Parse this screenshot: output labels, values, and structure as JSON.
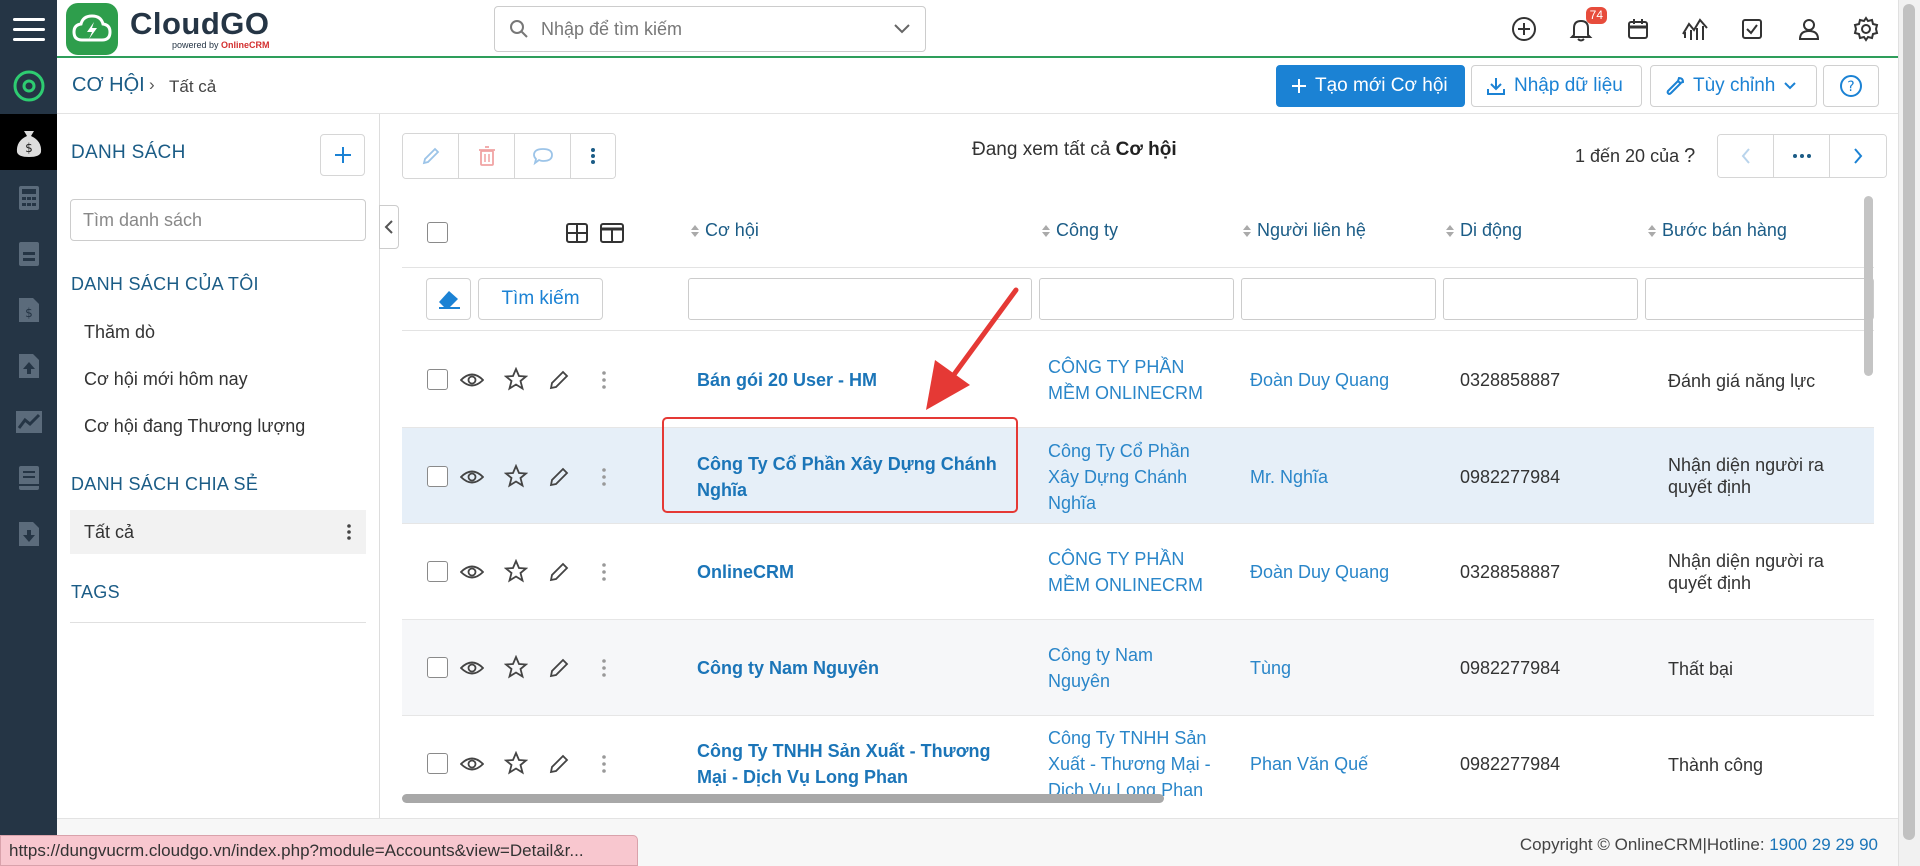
{
  "app": {
    "brand": "CloudGO",
    "brand_sub_prefix": "powered by",
    "brand_sub_name": "OnlineCRM",
    "brand_color": "#2e9e4c"
  },
  "topbar": {
    "search_placeholder": "Nhập để tìm kiếm",
    "notification_count": "74"
  },
  "header": {
    "module_title": "CƠ HỘI",
    "crumb_sep": "›",
    "crumb_current": "Tất cả",
    "create_button": "Tạo mới Cơ hội",
    "import_button": "Nhập dữ liệu",
    "customize_button": "Tùy chỉnh"
  },
  "sidebar": {
    "title": "DANH SÁCH",
    "search_placeholder": "Tìm danh sách",
    "my_lists_title": "DANH SÁCH CỦA TÔI",
    "my_lists": [
      "Thăm dò",
      "Cơ hội mới hôm nay",
      "Cơ hội đang Thương lượng"
    ],
    "shared_title": "DANH SÁCH CHIA SẺ",
    "shared_item": "Tất cả",
    "tags_title": "TAGS"
  },
  "main": {
    "viewing_prefix": "Đang xem tất cả",
    "viewing_module": "Cơ hội",
    "pager_text": "1 đến 20 của",
    "pager_unknown": "?",
    "filter_button": "Tìm kiếm",
    "columns": [
      "Cơ hội",
      "Công ty",
      "Người liên hệ",
      "Di động",
      "Bước bán hàng"
    ],
    "rows": [
      {
        "name": [
          "Bán gói 20 User - HM",
          ""
        ],
        "company": [
          "CÔNG TY PHẦN",
          "MỀM ONLINECRM",
          ""
        ],
        "contact": "Đoàn Duy Quang",
        "phone": "0328858887",
        "stage": [
          "Đánh giá năng lực",
          ""
        ]
      },
      {
        "name": [
          "Công Ty Cổ Phần Xây Dựng Chánh",
          "Nghĩa"
        ],
        "company": [
          "Công Ty Cổ Phần",
          "Xây Dựng Chánh",
          "Nghĩa"
        ],
        "contact": "Mr. Nghĩa",
        "phone": "0982277984",
        "stage": [
          "Nhận diện người ra",
          "quyết định"
        ]
      },
      {
        "name": [
          "OnlineCRM",
          ""
        ],
        "company": [
          "CÔNG TY PHẦN",
          "MỀM ONLINECRM",
          ""
        ],
        "contact": "Đoàn Duy Quang",
        "phone": "0328858887",
        "stage": [
          "Nhận diện người ra",
          "quyết định"
        ]
      },
      {
        "name": [
          "Công ty Nam Nguyên",
          ""
        ],
        "company": [
          "Công ty Nam",
          "Nguyên",
          ""
        ],
        "contact": "Tùng",
        "phone": "0982277984",
        "stage": [
          "Thất bại",
          ""
        ]
      },
      {
        "name": [
          "Công Ty TNHH Sản Xuất - Thương",
          "Mại - Dịch Vụ Long Phan"
        ],
        "company": [
          "Công Ty TNHH Sản",
          "Xuất - Thương Mại -",
          "Dịch Vụ Long Phan"
        ],
        "contact": "Phan Văn Quế",
        "phone": "0982277984",
        "stage": [
          "Thành công",
          ""
        ]
      }
    ]
  },
  "footer": {
    "copyright": "Copyright © OnlineCRM",
    "hotline_label": "|Hotline:",
    "hotline": "1900 29 29 90"
  },
  "status_url": "https://dungvucrm.cloudgo.vn/index.php?module=Accounts&view=Detail&r..."
}
